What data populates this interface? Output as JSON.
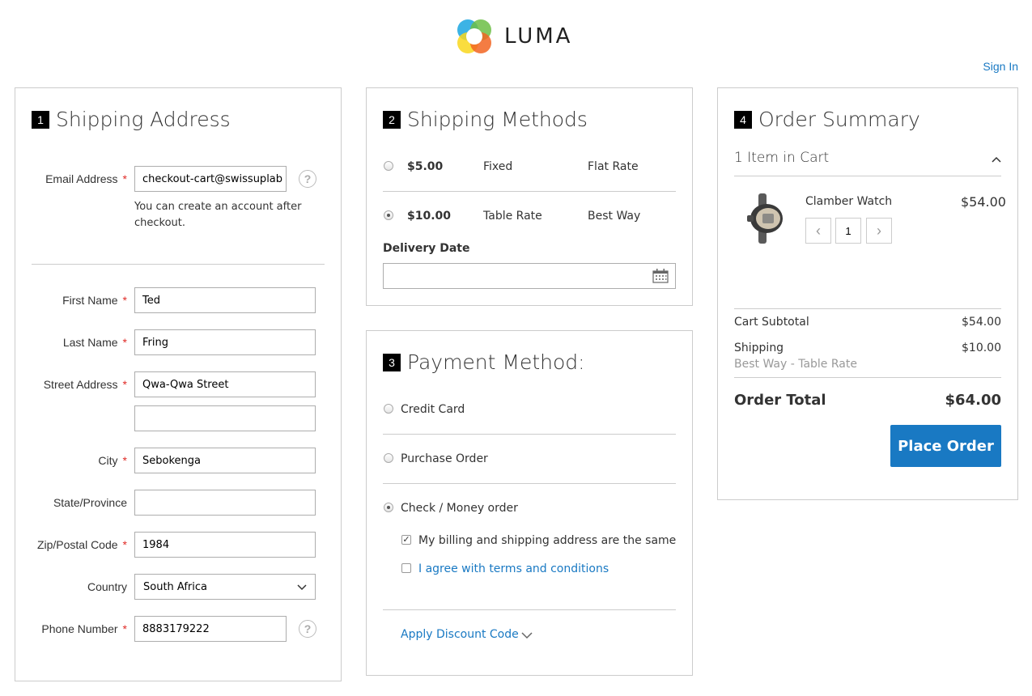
{
  "header": {
    "logo_text": "LUMA",
    "sign_in": "Sign In"
  },
  "shipping_address": {
    "step": "1",
    "title": "Shipping Address",
    "email_label": "Email Address",
    "email_value": "checkout-cart@swissuplab",
    "email_note": "You can create an account after checkout.",
    "first_name_label": "First Name",
    "first_name_value": "Ted",
    "last_name_label": "Last Name",
    "last_name_value": "Fring",
    "street_label": "Street Address",
    "street_value_1": "Qwa-Qwa Street",
    "street_value_2": "",
    "city_label": "City",
    "city_value": "Sebokenga",
    "state_label": "State/Province",
    "state_value": "",
    "zip_label": "Zip/Postal Code",
    "zip_value": "1984",
    "country_label": "Country",
    "country_value": "South Africa",
    "phone_label": "Phone Number",
    "phone_value": "8883179222",
    "required_mark": "*",
    "help_glyph": "?"
  },
  "shipping_methods": {
    "step": "2",
    "title": "Shipping Methods",
    "options": [
      {
        "price": "$5.00",
        "method": "Fixed",
        "carrier": "Flat Rate",
        "selected": false
      },
      {
        "price": "$10.00",
        "method": "Table Rate",
        "carrier": "Best Way",
        "selected": true
      }
    ],
    "delivery_date_label": "Delivery Date",
    "delivery_date_value": "",
    "calendar_icon": "calendar-icon"
  },
  "payment_method": {
    "step": "3",
    "title": "Payment Method:",
    "options": [
      {
        "label": "Credit Card",
        "selected": false
      },
      {
        "label": "Purchase Order",
        "selected": false
      },
      {
        "label": "Check / Money order",
        "selected": true
      }
    ],
    "billing_same_label": "My billing and shipping address are the same",
    "billing_same_checked": true,
    "terms_label": "I agree with terms and conditions",
    "terms_checked": false,
    "discount_label": "Apply Discount Code"
  },
  "order_summary": {
    "step": "4",
    "title": "Order Summary",
    "items_in_cart": "1 Item in Cart",
    "item": {
      "name": "Clamber Watch",
      "price": "$54.00",
      "qty": "1"
    },
    "subtotal_label": "Cart Subtotal",
    "subtotal_value": "$54.00",
    "shipping_label": "Shipping",
    "shipping_value": "$10.00",
    "shipping_method": "Best Way - Table Rate",
    "total_label": "Order Total",
    "total_value": "$64.00",
    "place_order": "Place Order"
  },
  "colors": {
    "accent": "#1979c3",
    "required": "#e02b27",
    "border": "#cccccc"
  }
}
